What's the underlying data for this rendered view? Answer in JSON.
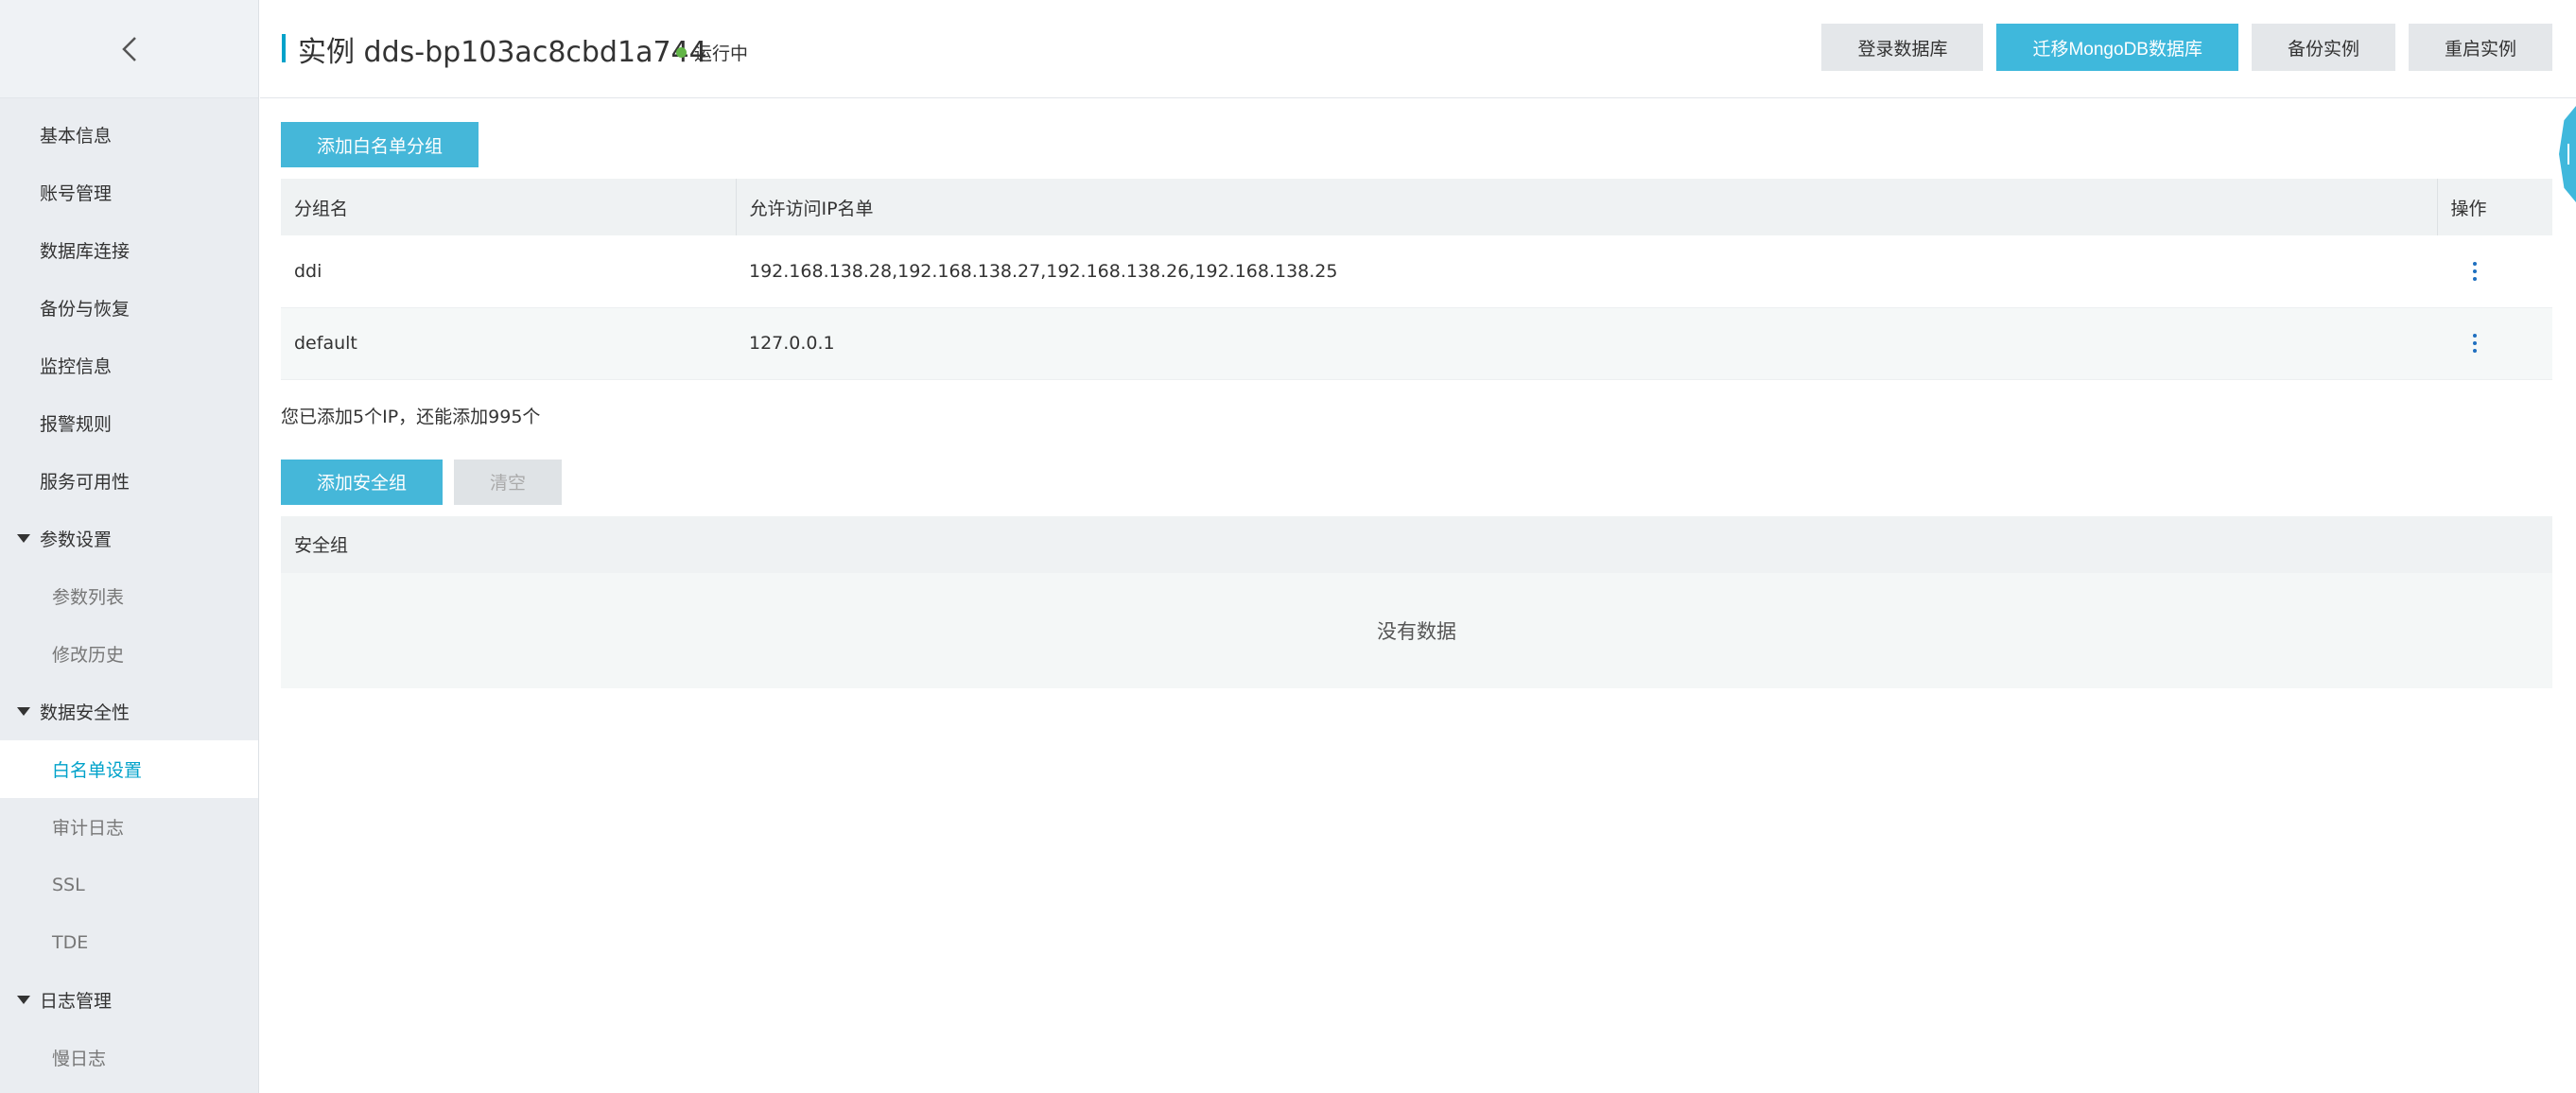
{
  "sidebar": {
    "back_icon": "chevron-left-icon",
    "items": [
      {
        "label": "基本信息"
      },
      {
        "label": "账号管理"
      },
      {
        "label": "数据库连接"
      },
      {
        "label": "备份与恢复"
      },
      {
        "label": "监控信息"
      },
      {
        "label": "报警规则"
      },
      {
        "label": "服务可用性"
      }
    ],
    "groups": [
      {
        "label": "参数设置",
        "children": [
          {
            "label": "参数列表"
          },
          {
            "label": "修改历史"
          }
        ]
      },
      {
        "label": "数据安全性",
        "children": [
          {
            "label": "白名单设置",
            "active": true
          },
          {
            "label": "审计日志"
          },
          {
            "label": "SSL"
          },
          {
            "label": "TDE"
          }
        ]
      },
      {
        "label": "日志管理",
        "children": [
          {
            "label": "慢日志"
          }
        ]
      }
    ]
  },
  "header": {
    "title_prefix": "实例",
    "title_id": "dds-bp103ac8cbd1a744",
    "status": "运行中",
    "status_color": "#62b547",
    "buttons": {
      "login": "登录数据库",
      "migrate": "迁移MongoDB数据库",
      "backup": "备份实例",
      "restart": "重启实例"
    }
  },
  "whitelist": {
    "add_button": "添加白名单分组",
    "columns": {
      "group": "分组名",
      "ips": "允许访问IP名单",
      "action": "操作"
    },
    "rows": [
      {
        "group": "ddi",
        "ips": "192.168.138.28,192.168.138.27,192.168.138.26,192.168.138.25"
      },
      {
        "group": "default",
        "ips": "127.0.0.1"
      }
    ],
    "summary": "您已添加5个IP，还能添加995个"
  },
  "security_group": {
    "add_button": "添加安全组",
    "clear_button": "清空",
    "column": "安全组",
    "empty": "没有数据"
  },
  "colors": {
    "accent": "#45b7d9",
    "active_text": "#00a2ca"
  }
}
